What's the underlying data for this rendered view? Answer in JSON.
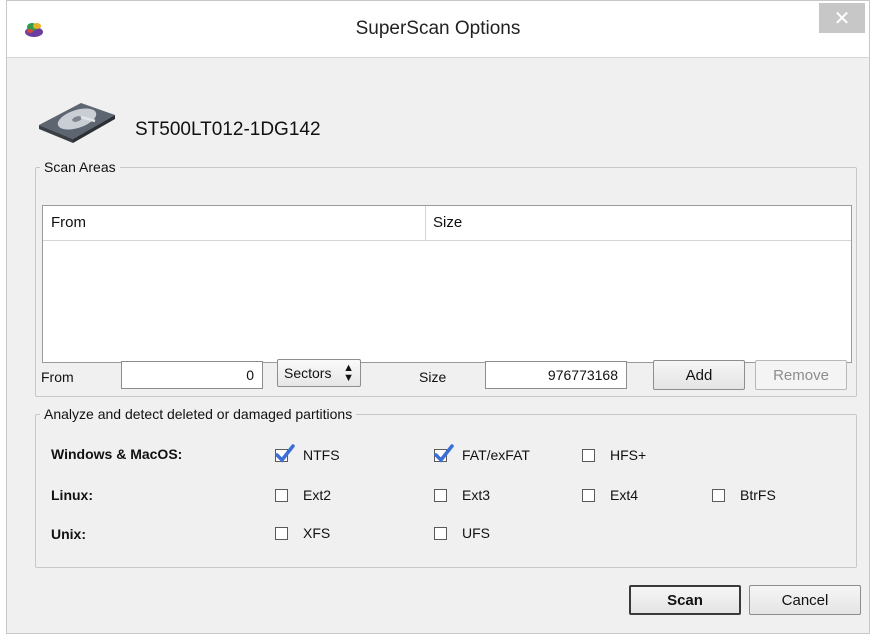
{
  "window": {
    "title": "SuperScan Options",
    "close_glyph": "✕"
  },
  "drive": {
    "name": "ST500LT012-1DG142"
  },
  "scan_areas": {
    "legend": "Scan Areas",
    "columns": [
      "From",
      "Size"
    ],
    "from_label": "From",
    "from_value": "0",
    "unit_selected": "Sectors",
    "size_label": "Size",
    "size_value": "976773168",
    "add_label": "Add",
    "remove_label": "Remove"
  },
  "partitions": {
    "legend": "Analyze and detect deleted or damaged partitions",
    "groups": [
      {
        "os": "Windows & MacOS:",
        "options": [
          {
            "label": "NTFS",
            "checked": true
          },
          {
            "label": "FAT/exFAT",
            "checked": true
          },
          {
            "label": "HFS+",
            "checked": false
          }
        ]
      },
      {
        "os": "Linux:",
        "options": [
          {
            "label": "Ext2",
            "checked": false
          },
          {
            "label": "Ext3",
            "checked": false
          },
          {
            "label": "Ext4",
            "checked": false
          },
          {
            "label": "BtrFS",
            "checked": false
          }
        ]
      },
      {
        "os": "Unix:",
        "options": [
          {
            "label": "XFS",
            "checked": false
          },
          {
            "label": "UFS",
            "checked": false
          }
        ]
      }
    ]
  },
  "footer": {
    "scan_label": "Scan",
    "cancel_label": "Cancel"
  },
  "colors": {
    "window_bg": "#f0f0f0",
    "check_blue": "#3b6fd8"
  }
}
